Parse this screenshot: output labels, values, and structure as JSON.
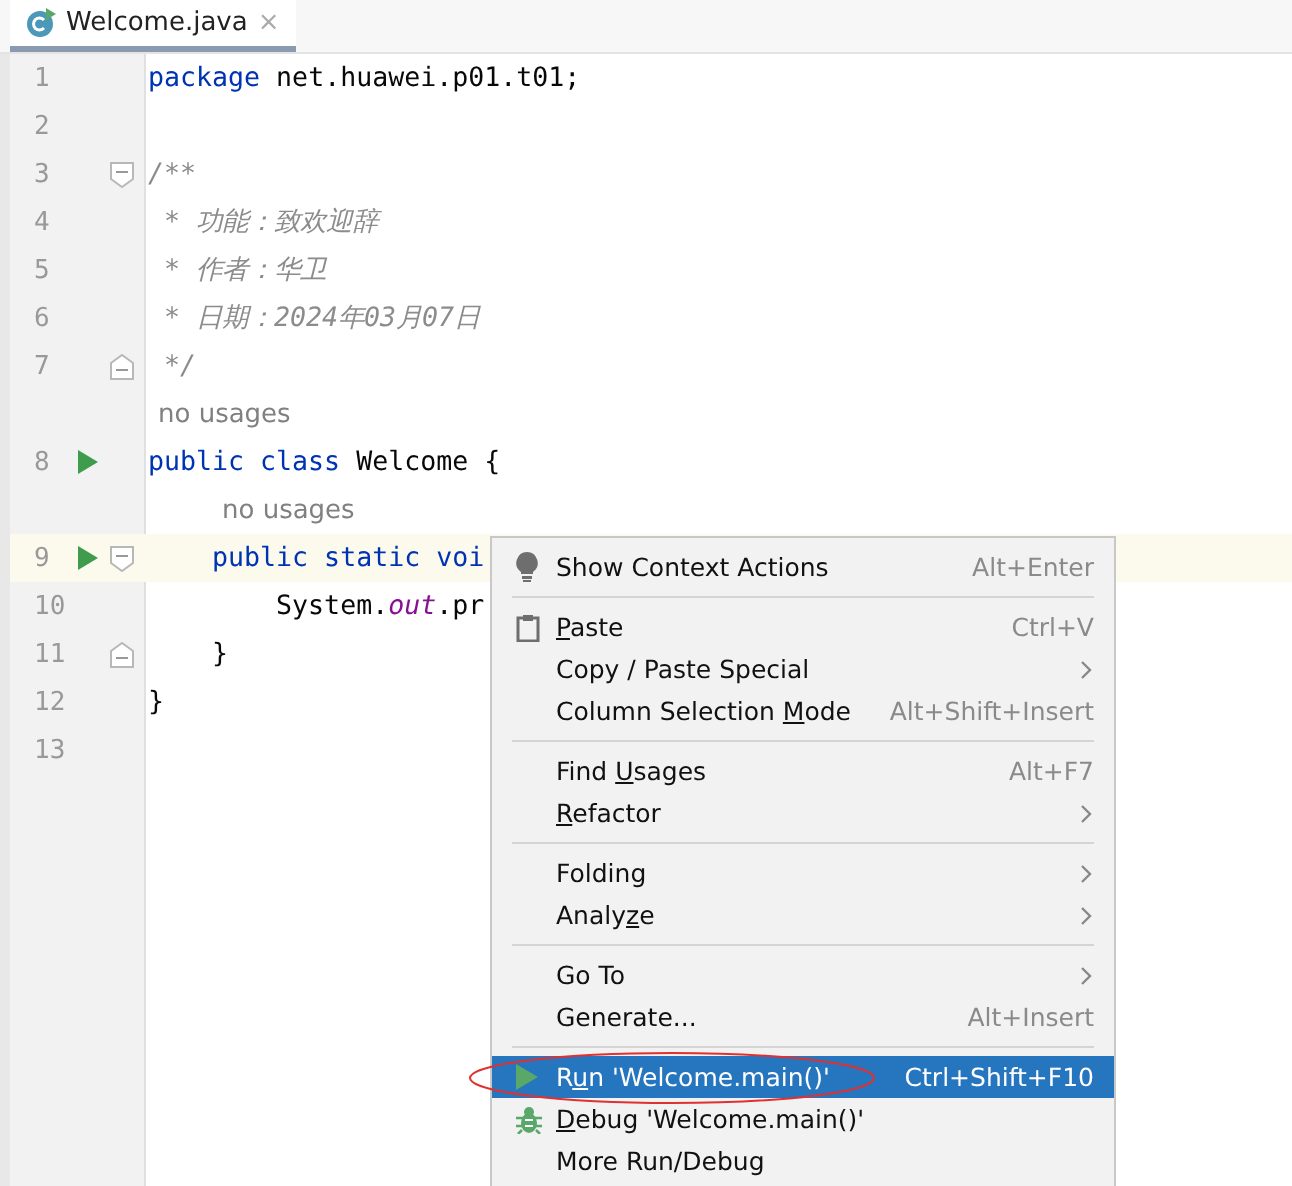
{
  "tabs": [
    {
      "label": "Welcome.java",
      "close": "×",
      "selected": true
    }
  ],
  "editor": {
    "rows": [
      {
        "kind": "code",
        "number": "1",
        "run": false,
        "fold_start": false,
        "fold_end": false,
        "current": false,
        "tokens": [
          {
            "kind": "keyword",
            "text": "package"
          },
          {
            "kind": "plain",
            "text": " net.huawei.p01.t01;"
          }
        ]
      },
      {
        "kind": "code",
        "number": "2",
        "run": false,
        "fold_start": false,
        "fold_end": false,
        "current": false,
        "tokens": []
      },
      {
        "kind": "code",
        "number": "3",
        "run": false,
        "fold_start": true,
        "fold_end": false,
        "current": false,
        "tokens": [
          {
            "kind": "comment",
            "text": "/**"
          }
        ]
      },
      {
        "kind": "code",
        "number": "4",
        "run": false,
        "fold_start": false,
        "fold_end": false,
        "current": false,
        "tokens": [
          {
            "kind": "comment",
            "text": " * 功能：致欢迎辞"
          }
        ]
      },
      {
        "kind": "code",
        "number": "5",
        "run": false,
        "fold_start": false,
        "fold_end": false,
        "current": false,
        "tokens": [
          {
            "kind": "comment",
            "text": " * 作者：华卫"
          }
        ]
      },
      {
        "kind": "code",
        "number": "6",
        "run": false,
        "fold_start": false,
        "fold_end": false,
        "current": false,
        "tokens": [
          {
            "kind": "comment",
            "text": " * 日期：2024年03月07日"
          }
        ]
      },
      {
        "kind": "code",
        "number": "7",
        "run": false,
        "fold_start": false,
        "fold_end": true,
        "current": false,
        "tokens": [
          {
            "kind": "comment",
            "text": " */"
          }
        ]
      },
      {
        "kind": "hint",
        "text": "no usages",
        "indent": false
      },
      {
        "kind": "code",
        "number": "8",
        "run": true,
        "fold_start": false,
        "fold_end": false,
        "current": false,
        "tokens": [
          {
            "kind": "keyword",
            "text": "public class"
          },
          {
            "kind": "plain",
            "text": " Welcome {"
          }
        ]
      },
      {
        "kind": "hint",
        "text": "no usages",
        "indent": true
      },
      {
        "kind": "code",
        "number": "9",
        "run": true,
        "fold_start": true,
        "fold_end": false,
        "current": true,
        "tokens": [
          {
            "kind": "keyword",
            "text": "    public static voi"
          }
        ]
      },
      {
        "kind": "code",
        "number": "10",
        "run": false,
        "fold_start": false,
        "fold_end": false,
        "current": false,
        "tokens": [
          {
            "kind": "plain",
            "text": "        System."
          },
          {
            "kind": "field",
            "text": "out"
          },
          {
            "kind": "plain",
            "text": ".pr"
          }
        ]
      },
      {
        "kind": "code",
        "number": "11",
        "run": false,
        "fold_start": false,
        "fold_end": true,
        "current": false,
        "tokens": [
          {
            "kind": "plain",
            "text": "    }"
          }
        ]
      },
      {
        "kind": "code",
        "number": "12",
        "run": false,
        "fold_start": false,
        "fold_end": false,
        "current": false,
        "tokens": [
          {
            "kind": "plain",
            "text": "}"
          }
        ]
      },
      {
        "kind": "code",
        "number": "13",
        "run": false,
        "fold_start": false,
        "fold_end": false,
        "current": false,
        "tokens": []
      }
    ]
  },
  "context_menu": {
    "groups": [
      {
        "items": [
          {
            "kind": "bulb",
            "label_before": "Show Context Actions",
            "shortcut": "Alt+Enter",
            "submenu": false,
            "selected": false
          }
        ]
      },
      {
        "items": [
          {
            "kind": "clipboard",
            "mnemonic": "P",
            "label_after": "aste",
            "shortcut": "Ctrl+V",
            "submenu": false,
            "selected": false
          },
          {
            "kind": "plain",
            "label_before": "Copy / Paste Special",
            "submenu": true,
            "selected": false
          },
          {
            "kind": "plain",
            "label_before": "Column Selection ",
            "mnemonic": "M",
            "label_after": "ode",
            "shortcut": "Alt+Shift+Insert",
            "submenu": false,
            "selected": false
          }
        ]
      },
      {
        "items": [
          {
            "kind": "plain",
            "label_before": "Find ",
            "mnemonic": "U",
            "label_after": "sages",
            "shortcut": "Alt+F7",
            "submenu": false,
            "selected": false
          },
          {
            "kind": "plain",
            "mnemonic": "R",
            "label_after": "efactor",
            "submenu": true,
            "selected": false
          }
        ]
      },
      {
        "items": [
          {
            "kind": "plain",
            "label_before": "Folding",
            "submenu": true,
            "selected": false
          },
          {
            "kind": "plain",
            "label_before": "Analy",
            "mnemonic": "z",
            "label_after": "e",
            "submenu": true,
            "selected": false
          }
        ]
      },
      {
        "items": [
          {
            "kind": "plain",
            "label_before": "Go To",
            "submenu": true,
            "selected": false
          },
          {
            "kind": "plain",
            "label_before": "Generate...",
            "shortcut": "Alt+Insert",
            "submenu": false,
            "selected": false
          }
        ]
      },
      {
        "items": [
          {
            "kind": "run",
            "label_before": "R",
            "mnemonic": "u",
            "label_after": "n 'Welcome.main()'",
            "shortcut": "Ctrl+Shift+F10",
            "submenu": false,
            "selected": true
          },
          {
            "kind": "debug",
            "mnemonic": "D",
            "label_after": "ebug 'Welcome.main()'",
            "submenu": false,
            "selected": false
          },
          {
            "kind": "plain",
            "label_before": "More Run/Debug",
            "submenu": false,
            "selected": false
          }
        ]
      }
    ]
  }
}
